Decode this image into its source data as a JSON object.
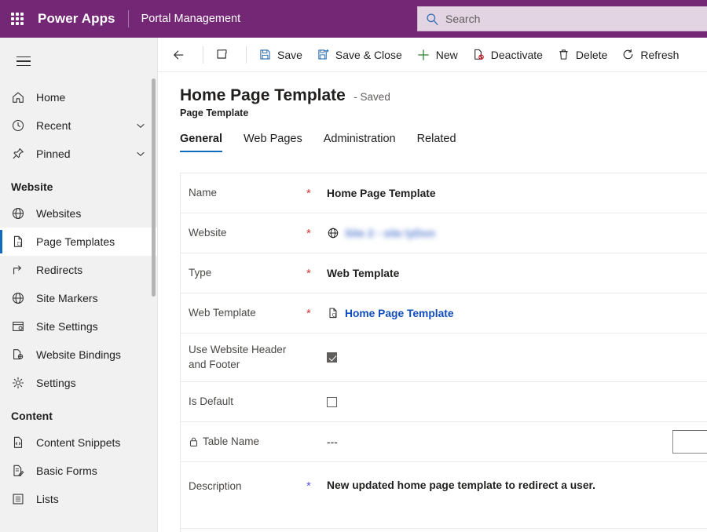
{
  "topbar": {
    "waffle_icon": "waffle-grid-icon",
    "brand": "Power Apps",
    "app_name": "Portal Management",
    "search": {
      "placeholder": "Search",
      "value": "",
      "icon": "search-icon"
    },
    "background_color": "#742774"
  },
  "sidebar": {
    "menu_icon": "hamburger-icon",
    "items": [
      {
        "label": "Home",
        "icon": "home-icon",
        "chevron": false,
        "selected": false
      },
      {
        "label": "Recent",
        "icon": "clock-icon",
        "chevron": true,
        "selected": false
      },
      {
        "label": "Pinned",
        "icon": "pin-icon",
        "chevron": true,
        "selected": false
      }
    ],
    "groups": [
      {
        "title": "Website",
        "items": [
          {
            "label": "Websites",
            "icon": "globe-icon",
            "selected": false
          },
          {
            "label": "Page Templates",
            "icon": "page-template-icon",
            "selected": true
          },
          {
            "label": "Redirects",
            "icon": "redirect-arrow-icon",
            "selected": false
          },
          {
            "label": "Site Markers",
            "icon": "globe-icon",
            "selected": false
          },
          {
            "label": "Site Settings",
            "icon": "site-settings-icon",
            "selected": false
          },
          {
            "label": "Website Bindings",
            "icon": "website-bindings-icon",
            "selected": false
          },
          {
            "label": "Settings",
            "icon": "gear-icon",
            "selected": false
          }
        ]
      },
      {
        "title": "Content",
        "items": [
          {
            "label": "Content Snippets",
            "icon": "code-page-icon",
            "selected": false
          },
          {
            "label": "Basic Forms",
            "icon": "form-edit-icon",
            "selected": false
          },
          {
            "label": "Lists",
            "icon": "list-icon",
            "selected": false
          }
        ]
      }
    ],
    "accent_color": "#0f6cbd"
  },
  "commandbar": {
    "buttons": [
      {
        "label": "",
        "icon": "back-arrow-icon"
      },
      {
        "label": "",
        "icon": "popout-icon"
      },
      {
        "label": "Save",
        "icon": "save-icon"
      },
      {
        "label": "Save & Close",
        "icon": "save-and-close-icon"
      },
      {
        "label": "New",
        "icon": "plus-icon"
      },
      {
        "label": "Deactivate",
        "icon": "deactivate-icon"
      },
      {
        "label": "Delete",
        "icon": "trash-icon"
      },
      {
        "label": "Refresh",
        "icon": "refresh-icon"
      }
    ]
  },
  "record": {
    "title": "Home Page Template",
    "status": "- Saved",
    "subtitle": "Page Template"
  },
  "tabs": [
    {
      "label": "General",
      "active": true
    },
    {
      "label": "Web Pages",
      "active": false
    },
    {
      "label": "Administration",
      "active": false
    },
    {
      "label": "Related",
      "active": false
    }
  ],
  "form": {
    "fields": [
      {
        "label": "Name",
        "required": true,
        "required_color": "red",
        "value": "Home Page Template",
        "kind": "text"
      },
      {
        "label": "Website",
        "required": true,
        "required_color": "red",
        "value": "Site 2 - site lyDon",
        "kind": "lookup-blurred",
        "icon": "globe-icon"
      },
      {
        "label": "Type",
        "required": true,
        "required_color": "red",
        "value": "Web Template",
        "kind": "text"
      },
      {
        "label": "Web Template",
        "required": true,
        "required_color": "red",
        "value": "Home Page Template",
        "kind": "link",
        "icon": "page-template-icon"
      },
      {
        "label": "Use Website Header and Footer",
        "required": false,
        "value": "",
        "kind": "checkbox",
        "checked": true
      },
      {
        "label": "Is Default",
        "required": false,
        "value": "",
        "kind": "checkbox",
        "checked": false
      },
      {
        "label": "Table Name",
        "required": false,
        "value": "---",
        "kind": "locked",
        "icon": "lock-icon",
        "has_tail_input": true,
        "tail_input_value": ""
      },
      {
        "label": "Description",
        "required": true,
        "required_color": "blue",
        "value": "New updated home page template to redirect a user.",
        "kind": "text"
      }
    ]
  }
}
